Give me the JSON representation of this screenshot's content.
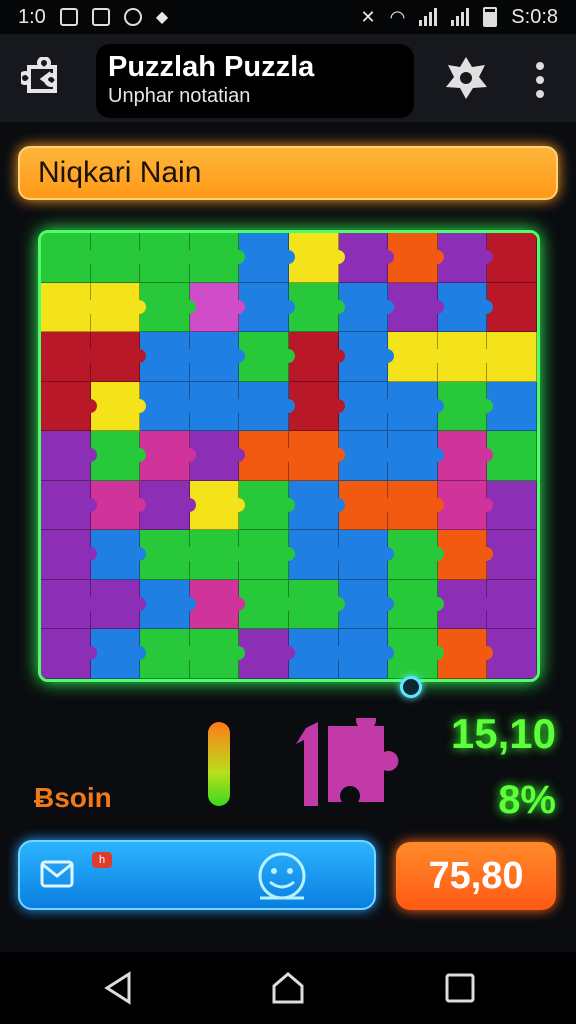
{
  "status": {
    "time": "1:0",
    "clock": "S:0:8"
  },
  "header": {
    "title": "Puzzlah Puzzla",
    "subtitle": "Unphar notatian"
  },
  "level": {
    "name": "Niqkari Nain"
  },
  "board": {
    "colors": {
      "g": "#27c93a",
      "b": "#1f7fe3",
      "y": "#f4e21b",
      "p": "#8c2fb6",
      "m": "#d0339a",
      "r": "#b81828",
      "o": "#f25a12",
      "k": "#d14cc8"
    },
    "rows": [
      "ggggbypopr",
      "yygkbgbpbr",
      "rrbbgrbyyy",
      "rybbbrbbgb",
      "pgmpoobbmg",
      "pmpygboomp",
      "pbgggbbgop",
      "ppbmggbgpp",
      "pbggpbbgop"
    ]
  },
  "stats": {
    "score": "15,10",
    "percent": "8%",
    "bonus_label": "Ƀsoin",
    "meter_level": 0.0
  },
  "actions": {
    "notif_badge": "h",
    "buy_value": "75,80"
  },
  "icons": {
    "back": "puzzle-back-icon",
    "badge": "puzzle-badge-icon",
    "menu": "more-vert-icon",
    "mail": "mail-icon",
    "face": "emoji-icon",
    "nav_back": "triangle-back-icon",
    "nav_home": "home-icon",
    "nav_recent": "square-recent-icon"
  }
}
